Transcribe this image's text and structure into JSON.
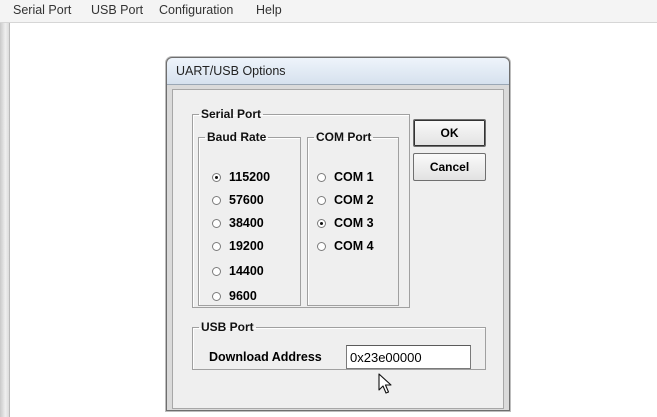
{
  "menu": {
    "items": [
      {
        "label": "Serial Port"
      },
      {
        "label": "USB Port"
      },
      {
        "label": "Configuration"
      },
      {
        "label": "Help"
      }
    ]
  },
  "dialog": {
    "title": "UART/USB Options",
    "serial_port": {
      "label": "Serial Port",
      "baud_rate": {
        "label": "Baud Rate",
        "options": [
          {
            "label": "115200",
            "selected": true
          },
          {
            "label": "57600",
            "selected": false
          },
          {
            "label": "38400",
            "selected": false
          },
          {
            "label": "19200",
            "selected": false
          },
          {
            "label": "14400",
            "selected": false
          },
          {
            "label": "9600",
            "selected": false
          }
        ]
      },
      "com_port": {
        "label": "COM Port",
        "options": [
          {
            "label": "COM 1",
            "selected": false
          },
          {
            "label": "COM 2",
            "selected": false
          },
          {
            "label": "COM 3",
            "selected": true
          },
          {
            "label": "COM 4",
            "selected": false
          }
        ]
      }
    },
    "buttons": {
      "ok": "OK",
      "cancel": "Cancel"
    },
    "usb_port": {
      "label": "USB Port",
      "download_address_label": "Download Address",
      "download_address_value": "0x23e00000"
    }
  },
  "icons": {
    "cursor": "mouse-pointer-icon"
  }
}
